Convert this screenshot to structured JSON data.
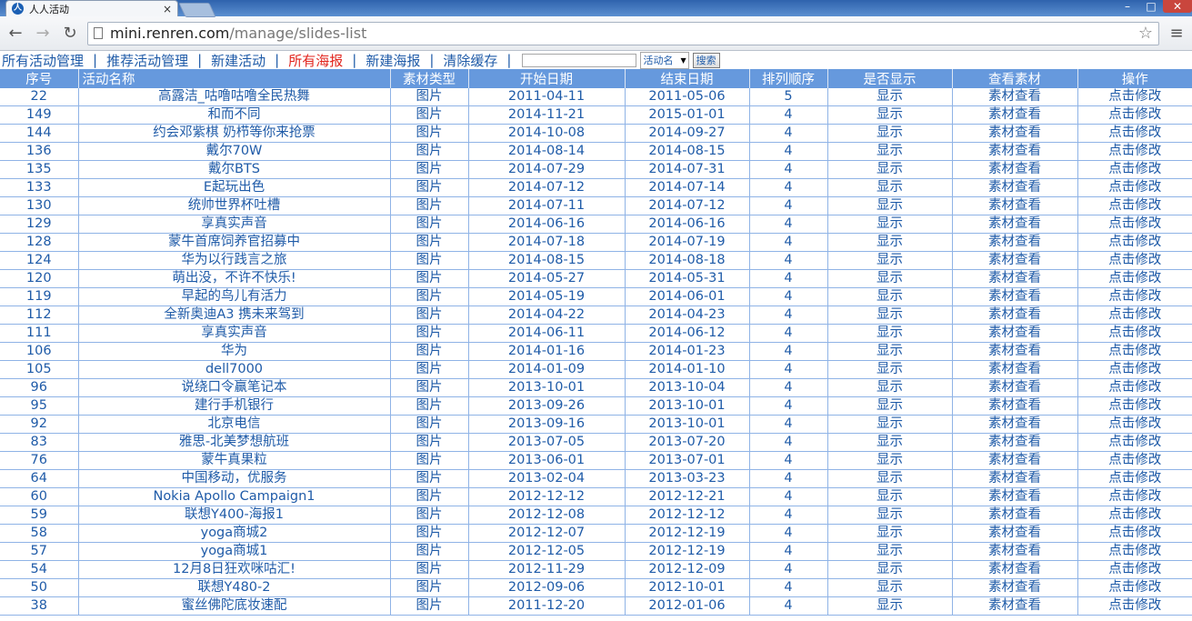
{
  "browser": {
    "tab_title": "人人活动",
    "favicon_glyph": "人",
    "url_host": "mini.renren.com",
    "url_path": "/manage/slides-list",
    "icons": {
      "back": "arrow-left-icon",
      "forward": "arrow-right-icon",
      "reload": "reload-icon",
      "star": "star-icon",
      "menu": "wrench-menu-icon",
      "close": "close-icon"
    }
  },
  "nav": {
    "items": [
      {
        "label": "所有活动管理",
        "active": false
      },
      {
        "label": "推荐活动管理",
        "active": false
      },
      {
        "label": "新建活动",
        "active": false
      },
      {
        "label": "所有海报",
        "active": true
      },
      {
        "label": "新建海报",
        "active": false
      },
      {
        "label": "清除缓存",
        "active": false
      }
    ],
    "separator": "|",
    "search_value": "",
    "select_value": "活动名",
    "search_button": "搜索"
  },
  "table": {
    "headers": [
      "序号",
      "活动名称",
      "素材类型",
      "开始日期",
      "结束日期",
      "排列顺序",
      "是否显示",
      "查看素材",
      "操作"
    ],
    "rows": [
      [
        "22",
        "高露洁_咕噜咕噜全民热舞",
        "图片",
        "2011-04-11",
        "2011-05-06",
        "5",
        "显示",
        "素材查看",
        "点击修改"
      ],
      [
        "149",
        "和而不同",
        "图片",
        "2014-11-21",
        "2015-01-01",
        "4",
        "显示",
        "素材查看",
        "点击修改"
      ],
      [
        "144",
        "约会邓紫棋 奶栉等你来抢票",
        "图片",
        "2014-10-08",
        "2014-09-27",
        "4",
        "显示",
        "素材查看",
        "点击修改"
      ],
      [
        "136",
        "戴尔70W",
        "图片",
        "2014-08-14",
        "2014-08-15",
        "4",
        "显示",
        "素材查看",
        "点击修改"
      ],
      [
        "135",
        "戴尔BTS",
        "图片",
        "2014-07-29",
        "2014-07-31",
        "4",
        "显示",
        "素材查看",
        "点击修改"
      ],
      [
        "133",
        "E起玩出色",
        "图片",
        "2014-07-12",
        "2014-07-14",
        "4",
        "显示",
        "素材查看",
        "点击修改"
      ],
      [
        "130",
        "统帅世界杯吐槽",
        "图片",
        "2014-07-11",
        "2014-07-12",
        "4",
        "显示",
        "素材查看",
        "点击修改"
      ],
      [
        "129",
        "享真实声音",
        "图片",
        "2014-06-16",
        "2014-06-16",
        "4",
        "显示",
        "素材查看",
        "点击修改"
      ],
      [
        "128",
        "蒙牛首席饲养官招募中",
        "图片",
        "2014-07-18",
        "2014-07-19",
        "4",
        "显示",
        "素材查看",
        "点击修改"
      ],
      [
        "124",
        "华为以行践言之旅",
        "图片",
        "2014-08-15",
        "2014-08-18",
        "4",
        "显示",
        "素材查看",
        "点击修改"
      ],
      [
        "120",
        "萌出没，不许不快乐!",
        "图片",
        "2014-05-27",
        "2014-05-31",
        "4",
        "显示",
        "素材查看",
        "点击修改"
      ],
      [
        "119",
        "早起的鸟儿有活力",
        "图片",
        "2014-05-19",
        "2014-06-01",
        "4",
        "显示",
        "素材查看",
        "点击修改"
      ],
      [
        "112",
        "全新奥迪A3 携未来驾到",
        "图片",
        "2014-04-22",
        "2014-04-23",
        "4",
        "显示",
        "素材查看",
        "点击修改"
      ],
      [
        "111",
        "享真实声音",
        "图片",
        "2014-06-11",
        "2014-06-12",
        "4",
        "显示",
        "素材查看",
        "点击修改"
      ],
      [
        "106",
        "华为",
        "图片",
        "2014-01-16",
        "2014-01-23",
        "4",
        "显示",
        "素材查看",
        "点击修改"
      ],
      [
        "105",
        "dell7000",
        "图片",
        "2014-01-09",
        "2014-01-10",
        "4",
        "显示",
        "素材查看",
        "点击修改"
      ],
      [
        "96",
        "说绕口令赢笔记本",
        "图片",
        "2013-10-01",
        "2013-10-04",
        "4",
        "显示",
        "素材查看",
        "点击修改"
      ],
      [
        "95",
        "建行手机银行",
        "图片",
        "2013-09-26",
        "2013-10-01",
        "4",
        "显示",
        "素材查看",
        "点击修改"
      ],
      [
        "92",
        "北京电信",
        "图片",
        "2013-09-16",
        "2013-10-01",
        "4",
        "显示",
        "素材查看",
        "点击修改"
      ],
      [
        "83",
        "雅思-北美梦想航班",
        "图片",
        "2013-07-05",
        "2013-07-20",
        "4",
        "显示",
        "素材查看",
        "点击修改"
      ],
      [
        "76",
        "蒙牛真果粒",
        "图片",
        "2013-06-01",
        "2013-07-01",
        "4",
        "显示",
        "素材查看",
        "点击修改"
      ],
      [
        "64",
        "中国移动，优服务",
        "图片",
        "2013-02-04",
        "2013-03-23",
        "4",
        "显示",
        "素材查看",
        "点击修改"
      ],
      [
        "60",
        "Nokia Apollo Campaign1",
        "图片",
        "2012-12-12",
        "2012-12-21",
        "4",
        "显示",
        "素材查看",
        "点击修改"
      ],
      [
        "59",
        "联想Y400-海报1",
        "图片",
        "2012-12-08",
        "2012-12-12",
        "4",
        "显示",
        "素材查看",
        "点击修改"
      ],
      [
        "58",
        "yoga商城2",
        "图片",
        "2012-12-07",
        "2012-12-19",
        "4",
        "显示",
        "素材查看",
        "点击修改"
      ],
      [
        "57",
        "yoga商城1",
        "图片",
        "2012-12-05",
        "2012-12-19",
        "4",
        "显示",
        "素材查看",
        "点击修改"
      ],
      [
        "54",
        "12月8日狂欢咪咕汇!",
        "图片",
        "2012-11-29",
        "2012-12-09",
        "4",
        "显示",
        "素材查看",
        "点击修改"
      ],
      [
        "50",
        "联想Y480-2",
        "图片",
        "2012-09-06",
        "2012-10-01",
        "4",
        "显示",
        "素材查看",
        "点击修改"
      ],
      [
        "38",
        "蜜丝佛陀底妆速配",
        "图片",
        "2011-12-20",
        "2012-01-06",
        "4",
        "显示",
        "素材查看",
        "点击修改"
      ]
    ]
  },
  "colors": {
    "header_bg": "#6699dd",
    "link": "#1f5ba8",
    "active_link": "#e2261f",
    "grid_line": "#8fb3e6"
  }
}
